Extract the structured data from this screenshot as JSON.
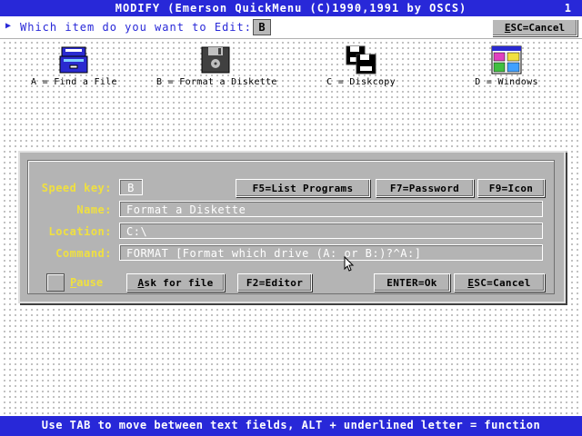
{
  "titlebar": {
    "title": "MODIFY (Emerson QuickMenu (C)1990,1991 by OSCS)",
    "page_number": "1"
  },
  "prompt": {
    "text": "Which item do you want to Edit:",
    "selected_key": "B",
    "esc_button_prefix": "E",
    "esc_button_rest": "SC=Cancel"
  },
  "menu_items": [
    {
      "label": "A = Find a File",
      "icon": "file-cabinet-icon"
    },
    {
      "label": "B = Format a Diskette",
      "icon": "diskette-icon"
    },
    {
      "label": "C = Diskcopy",
      "icon": "diskcopy-icon"
    },
    {
      "label": "D = Windows",
      "icon": "windows-icon"
    }
  ],
  "dialog": {
    "speed_key_label": "Speed key:",
    "speed_key_value": "B",
    "name_label": "Name:",
    "name_value": "Format a Diskette",
    "location_label": "Location:",
    "location_value": "C:\\",
    "command_label": "Command:",
    "command_value": "FORMAT [Format which drive (A: or B:)?^A:]",
    "pause_first": "P",
    "pause_rest": "ause",
    "buttons": {
      "f5_list": "F5=List Programs",
      "f7_password": "F7=Password",
      "f9_icon": "F9=Icon",
      "ask_for_file_first": "A",
      "ask_for_file_rest": "sk for file",
      "f2_editor": "F2=Editor",
      "enter_ok": "ENTER=Ok",
      "esc_cancel_first": "E",
      "esc_cancel_rest": "SC=Cancel"
    }
  },
  "statusbar": {
    "text": "Use TAB to move between text fields, ALT + underlined letter = function"
  },
  "colors": {
    "title_bar": "#2828d8",
    "label_yellow": "#f0e040",
    "dialog_gray": "#b4b4b4"
  }
}
